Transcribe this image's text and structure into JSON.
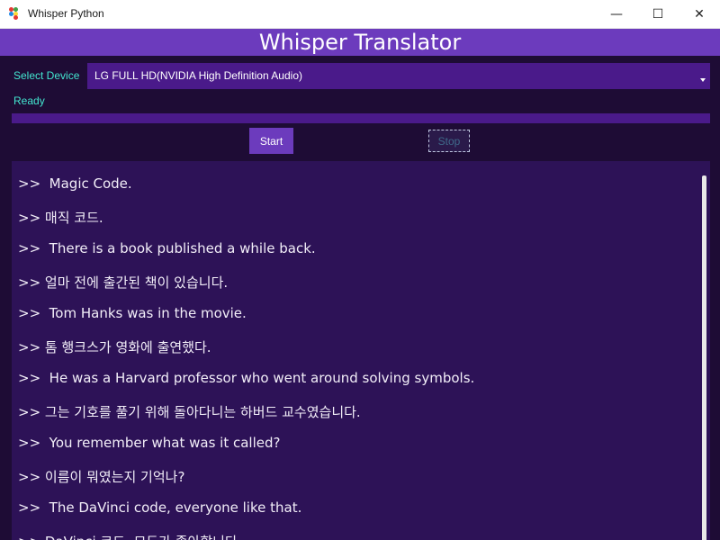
{
  "window": {
    "title": "Whisper Python",
    "minimize_glyph": "—",
    "maximize_glyph": "☐",
    "close_glyph": "✕"
  },
  "header": {
    "title": "Whisper Translator"
  },
  "device": {
    "label": "Select Device",
    "selected": "LG FULL HD(NVIDIA High Definition Audio)"
  },
  "status": {
    "text": "Ready"
  },
  "progress": {
    "value": 0
  },
  "buttons": {
    "start": "Start",
    "stop": "Stop"
  },
  "transcript": {
    "lines": [
      ">>  Magic Code.",
      ">> 매직 코드.",
      ">>  There is a book published a while back.",
      ">> 얼마 전에 출간된 책이 있습니다.",
      ">>  Tom Hanks was in the movie.",
      ">> 톰 행크스가 영화에 출연했다.",
      ">>  He was a Harvard professor who went around solving symbols.",
      ">> 그는 기호를 풀기 위해 돌아다니는 하버드 교수였습니다.",
      ">>  You remember what was it called?",
      ">> 이름이 뭐였는지 기억나?",
      ">>  The DaVinci code, everyone like that.",
      ">> DaVinci 코드, 모두가 좋아합니다."
    ]
  },
  "colors": {
    "accent": "#6c3bbd",
    "label": "#43e6d0",
    "background": "#1e0c35",
    "panel": "#2d1257"
  }
}
